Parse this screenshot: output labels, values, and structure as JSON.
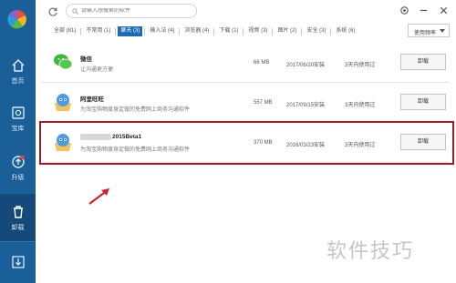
{
  "sidebar": {
    "logo_icon": "pinwheel-logo-icon",
    "items": [
      {
        "label": "首页",
        "icon": "home-icon"
      },
      {
        "label": "宝库",
        "icon": "treasure-box-icon"
      },
      {
        "label": "升级",
        "icon": "upgrade-icon"
      },
      {
        "label": "卸载",
        "icon": "trash-icon"
      }
    ],
    "bottom_icon": "download-icon",
    "active_index": 3
  },
  "search": {
    "placeholder": "请输入想搜索的软件"
  },
  "tabs": [
    {
      "label": "全部 (81)"
    },
    {
      "label": "不常用 (1)"
    },
    {
      "label": "聊天 (3)"
    },
    {
      "label": "输入法 (4)"
    },
    {
      "label": "浏览器 (4)"
    },
    {
      "label": "下载 (1)"
    },
    {
      "label": "视频 (3)"
    },
    {
      "label": "图片 (2)"
    },
    {
      "label": "安全 (3)"
    },
    {
      "label": "系统 (6)"
    }
  ],
  "active_tab": 2,
  "sort": {
    "label": "使用频率"
  },
  "apps": [
    {
      "name": "微信",
      "desc": "让沟通更方便",
      "size": "66 MB",
      "date": "2017/06/20安装",
      "used": "3天内使用过",
      "action": "卸载",
      "icon": "wechat-icon"
    },
    {
      "name": "阿里旺旺",
      "desc": "为淘宝购物度身定做的免费网上商务沟通软件",
      "size": "557 MB",
      "date": "2017/09/15安装",
      "used": "3天内使用过",
      "action": "卸载",
      "icon": "aliwangwang-icon"
    },
    {
      "name": "2015Beta1",
      "desc": "为淘宝购物度身定做的免费网上商务沟通软件",
      "size": "370 MB",
      "date": "2016/03/23安装",
      "used": "3天内使用过",
      "action": "卸载",
      "icon": "aliwangwang-icon"
    }
  ],
  "watermark": "软件技巧",
  "colors": {
    "sidebar": "#1a5f98",
    "sidebar_active": "#14497a",
    "tab_active": "#1c6bb5",
    "highlight": "#9b1f23"
  }
}
